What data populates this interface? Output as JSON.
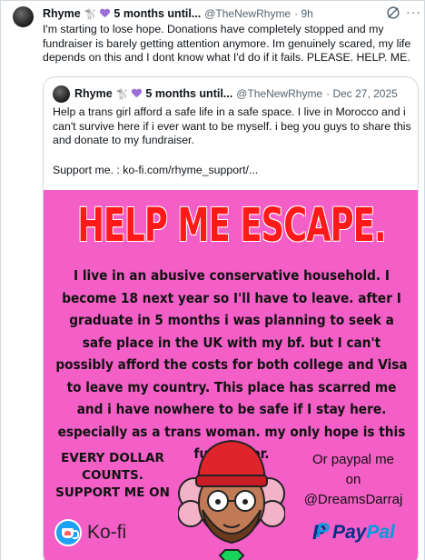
{
  "tweet": {
    "display_name": "Rhyme",
    "badge_dog": "🐩",
    "name_suffix": "5 months until...",
    "handle": "@TheNewRhyme",
    "time": "· 9h",
    "text": "I'm starting to lose hope. Donations have completely stopped and my fundraiser is barely getting attention anymore. Im genuinely scared, my life depends on this and I dont know what I'd do if it fails. PLEASE. HELP. ME.",
    "icons": [
      "grok-icon",
      "more-icon"
    ]
  },
  "quoted": {
    "display_name": "Rhyme",
    "badge_dog": "🐩",
    "name_suffix": "5 months until...",
    "handle": "@TheNewRhyme",
    "date": "· Dec 27, 2025",
    "text": "Help a trans girl afford a safe life in a safe space. I live in Morocco and i can't survive here if i ever want to be myself. i beg you guys to share this and donate to my fundraiser.",
    "support": "Support me. : ko-fi.com/rhyme_support/..."
  },
  "poster": {
    "background": "#f35fc7",
    "title": "HELP ME ESCAPE.",
    "title_color": "#ff1a1a",
    "body": "I live in an abusive conservative household. I become 18 next year so I'll have to leave. after I graduate in 5 months i was planning to seek a safe place in the UK with my bf. but I can't possibly afford the costs for both college and Visa to leave my country. This place has scarred me and i have nowhere to be safe if I stay here. especially as a trans woman. my only hope is this fundraiser.",
    "every_dollar": "EVERY DOLLAR COUNTS. SUPPORT ME ON",
    "paypal_line1": "Or paypal me",
    "paypal_line2": "on",
    "paypal_line3": "@DreamsDarraj",
    "kofi_label": "Ko-fi",
    "paypal_a": "Pay",
    "paypal_b": "Pal",
    "paypal_mark": "P"
  }
}
